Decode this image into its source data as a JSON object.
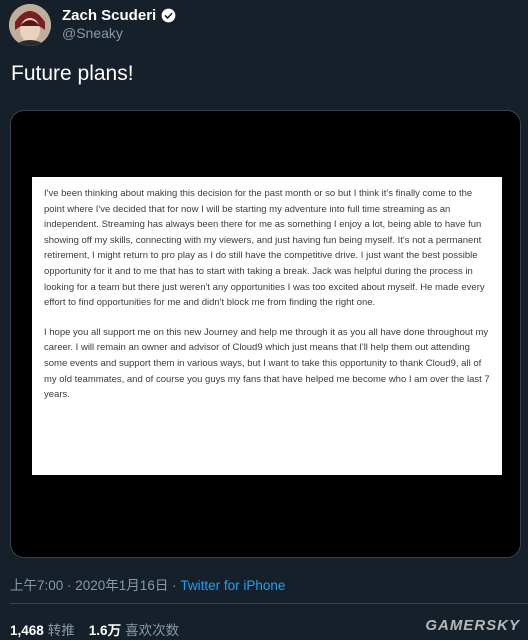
{
  "tweet": {
    "display_name": "Zach Scuderi",
    "handle": "@Sneaky",
    "text": "Future plans!",
    "timestamp": "上午7:00 · 2020年1月16日 · ",
    "source": "Twitter for iPhone",
    "retweets": "1,468",
    "retweets_label": "转推",
    "likes": "1.6万",
    "likes_label": "喜欢次数"
  },
  "letter": {
    "paragraph1": "I've been thinking about making this decision for the past month or so but I think it's finally come to the point where I've decided that for now I will be starting my adventure into full time streaming as an independent. Streaming has always been there for me as something I enjoy a lot, being able to have fun showing off my skills, connecting with my viewers, and just having fun being myself. It's not a permanent retirement, I might return to pro play as I do still have the competitive drive. I just want the best possible opportunity for it and to me that has to start with taking a break. Jack was helpful during the process in looking for a team but there just weren't any opportunities I was too excited about myself. He made every effort to find opportunities for me and didn't block me from finding the right one.",
    "paragraph2": "I hope you all support me on this new Journey and help me through it as you all have done throughout my career. I will remain an owner and advisor of Cloud9 which just means that I'll help them out attending some events and support them in various ways, but I want to take this opportunity to thank Cloud9, all of my old teammates, and of course you guys my fans that have helped me become who I am over the last 7 years."
  },
  "watermark": "GAMERSKY",
  "colors": {
    "background": "#15202b",
    "link": "#1da1f2",
    "muted": "#8899a6"
  },
  "icons": {
    "verified": "verified-badge-icon"
  }
}
